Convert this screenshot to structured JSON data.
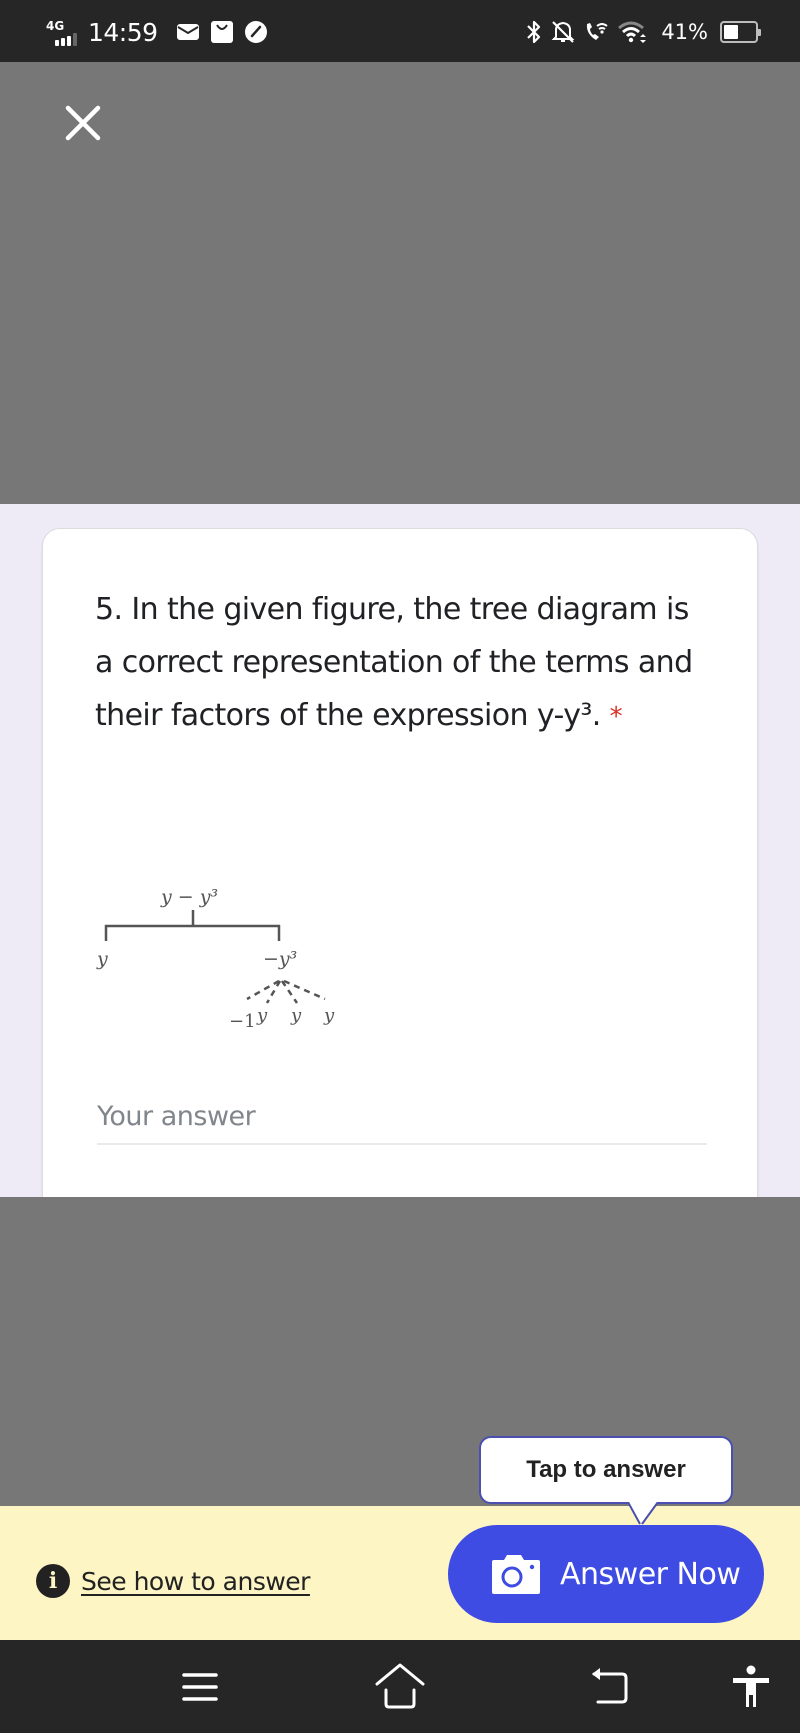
{
  "status_bar": {
    "network": "4G",
    "signal_strength": "3 of 4 bars",
    "time": "14:59",
    "notification_icons": [
      "mail-icon",
      "shopping-bag-icon",
      "speedometer-icon"
    ],
    "system_icons": [
      "bluetooth-icon",
      "bell-off-icon",
      "wifi-calling-icon",
      "wifi-icon"
    ],
    "battery_percent": "41%",
    "battery_level": 0.41
  },
  "overlay": {
    "close_icon": "close-icon"
  },
  "question": {
    "number": "5.",
    "text": "In the given figure, the tree diagram is a correct representation of the terms and their factors of the expression y-y³.",
    "required_marker": "*",
    "figure": {
      "root": "y − y³",
      "left_term": "y",
      "right_term": "−y³",
      "right_factors": [
        "−1",
        "y",
        "y",
        "y"
      ]
    },
    "answer_placeholder": "Your answer",
    "answer_value": ""
  },
  "answer_bar": {
    "tooltip": "Tap to answer",
    "how_link": "See how to answer",
    "answer_button": "Answer Now",
    "accent_color": "#3f4ce4",
    "bar_color": "#fdf5c4"
  },
  "nav_bar": {
    "buttons": [
      "recent-apps",
      "home",
      "back",
      "accessibility"
    ]
  }
}
